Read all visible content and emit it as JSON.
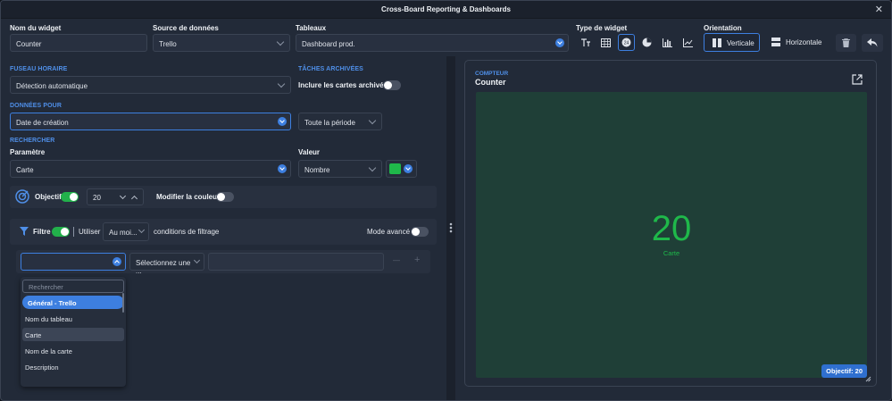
{
  "window": {
    "title": "Cross-Board Reporting & Dashboards",
    "close_glyph": "✕"
  },
  "header": {
    "widget_name_label": "Nom du widget",
    "widget_name_value": "Counter",
    "data_source_label": "Source de données",
    "data_source_value": "Trello",
    "boards_label": "Tableaux",
    "boards_value": "Dashboard prod.",
    "widget_type_label": "Type de widget",
    "widget_types": [
      "text-icon",
      "table-icon",
      "counter-icon",
      "pie-icon",
      "bar-chart-icon",
      "line-chart-icon"
    ],
    "orientation_label": "Orientation",
    "orientation_vertical": "Verticale",
    "orientation_horizontal": "Horizontale"
  },
  "timezone": {
    "section": "Fuseau horaire",
    "value": "Détection automatique"
  },
  "archived": {
    "section": "Tâches archivées",
    "label": "Inclure les cartes archivées",
    "enabled": false
  },
  "data_for": {
    "section": "Données pour",
    "value": "Date de création",
    "period": "Toute la période"
  },
  "search": {
    "section": "Rechercher",
    "param_label": "Paramètre",
    "param_value": "Carte",
    "value_label": "Valeur",
    "value_value": "Nombre",
    "color": "#1fb84a"
  },
  "objective": {
    "label": "Objectif",
    "enabled": true,
    "value": "20",
    "color_label": "Modifier la couleur",
    "color_enabled": false
  },
  "filter": {
    "label": "Filtre",
    "enabled": true,
    "use_label": "Utiliser",
    "use_value": "Au moi...",
    "conditions_label": "conditions de filtrage",
    "advanced_label": "Mode avancé",
    "advanced_enabled": false,
    "select_placeholder": "Sélectionnez une ...",
    "minus": "—",
    "plus": "+"
  },
  "dropdown": {
    "search_placeholder": "Rechercher",
    "group": "Général - Trello",
    "items": [
      "Nom du tableau",
      "Carte",
      "Nom de la carte",
      "Description"
    ],
    "highlighted": "Carte"
  },
  "preview": {
    "caption": "Compteur",
    "title": "Counter",
    "value": "20",
    "sublabel": "Carte",
    "objective_badge": "Objectif: 20",
    "accent": "#1fb84a",
    "bg": "#1f3f37"
  }
}
